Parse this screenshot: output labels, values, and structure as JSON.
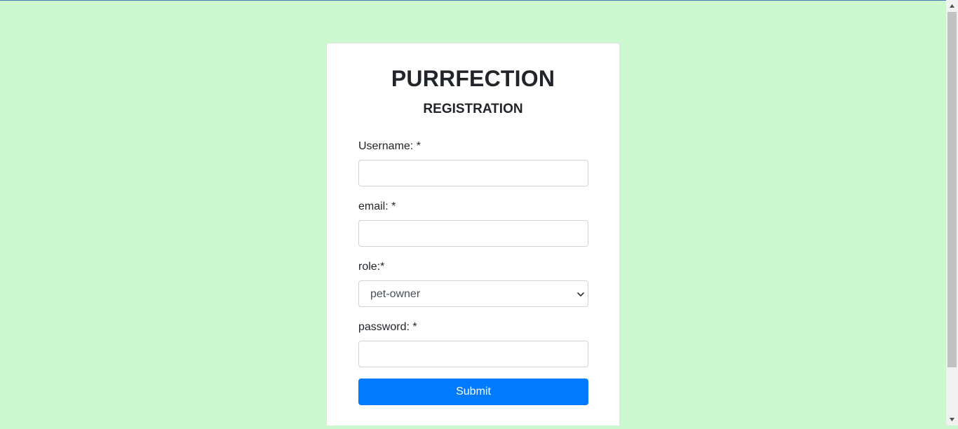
{
  "app": {
    "title": "PURRFECTION",
    "subtitle": "REGISTRATION"
  },
  "form": {
    "username": {
      "label": "Username: *",
      "value": ""
    },
    "email": {
      "label": "email: *",
      "value": ""
    },
    "role": {
      "label": "role:*",
      "selected": "pet-owner"
    },
    "password": {
      "label": "password: *",
      "value": ""
    },
    "submit_label": "Submit"
  },
  "colors": {
    "background": "#ccf7cf",
    "primary_button": "#007bff",
    "card": "#ffffff"
  },
  "icons": {
    "select_arrow": "chevron-down-icon",
    "scroll_up": "triangle-up-icon",
    "scroll_down": "triangle-down-icon"
  }
}
